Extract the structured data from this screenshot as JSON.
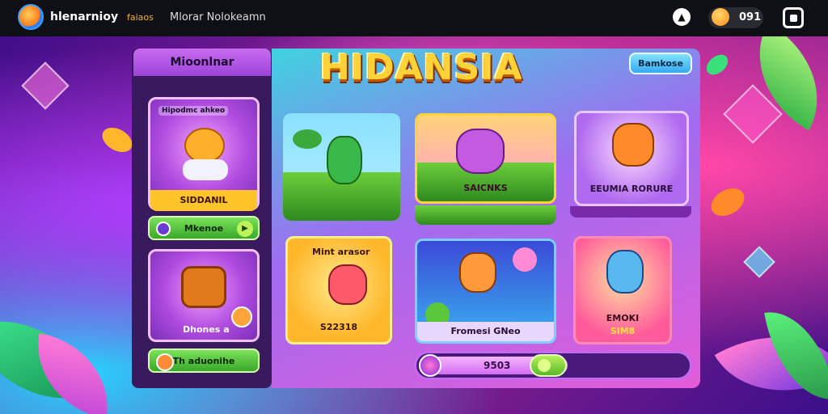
{
  "topbar": {
    "app_name": "hlenarnioy",
    "link_1": "faiaos",
    "link_2": "Mlorar Nolokeamn",
    "coins": "091"
  },
  "sidebar": {
    "title": "Mioonlnar",
    "cards": [
      {
        "title": "Hipodmc ahkeo",
        "label": "SIDDANIL"
      },
      {
        "title": "",
        "caption": "Dhones a"
      }
    ],
    "buttons": [
      {
        "label": "Mkenoe"
      },
      {
        "label": "Th aduonihe"
      }
    ]
  },
  "main": {
    "title": "HIDANSIA",
    "top_button": "Bamkose",
    "cards": [
      {
        "label": ""
      },
      {
        "label": "SAICNKS"
      },
      {
        "label": "EEUMIA RORURE"
      },
      {
        "title": "Mint arasor",
        "label": "S22318"
      },
      {
        "label": "Fromesi GNeo"
      },
      {
        "label": "EMOKI",
        "sub": "SIM8"
      }
    ],
    "progress": {
      "value": "9503",
      "fill": 0.55
    }
  },
  "colors": {
    "accent_gold": "#ffd23a",
    "accent_green": "#7be25a",
    "accent_purple": "#b04be0",
    "accent_cyan": "#3fd3e0"
  }
}
